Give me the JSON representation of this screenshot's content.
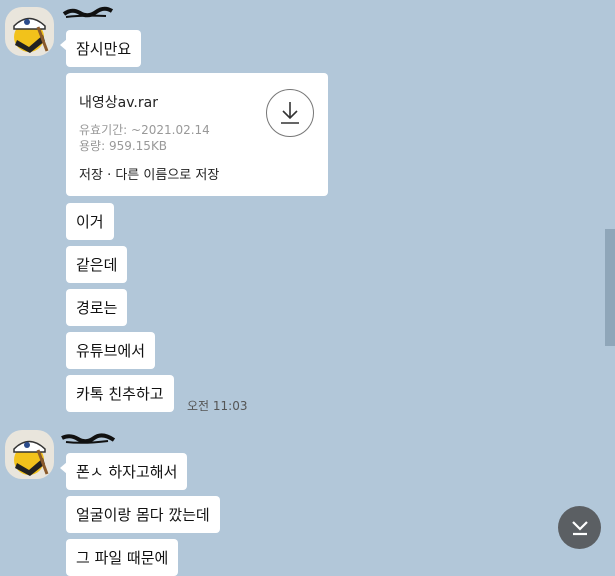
{
  "messages": [
    {
      "text": "잠시만요"
    },
    {
      "file": {
        "name": "내영상av.rar",
        "expiry_label": "유효기간:",
        "expiry_value": "~2021.02.14",
        "size_label": "용량:",
        "size_value": "959.15KB",
        "save_label": "저장",
        "separator": "·",
        "save_as_label": "다른 이름으로 저장"
      }
    },
    {
      "text": "이거"
    },
    {
      "text": "같은데"
    },
    {
      "text": "경로는"
    },
    {
      "text": "유튜브에서"
    },
    {
      "text": "카톡 친추하고",
      "time": "오전 11:03"
    },
    {
      "text": "폰ㅅ 하자고해서"
    },
    {
      "text": "얼굴이랑 몸다 깠는데"
    },
    {
      "text": "그 파일 때문에"
    }
  ],
  "icons": {
    "avatar": "avatar-icon",
    "download": "download-icon",
    "scroll_down": "scroll-to-bottom-icon"
  },
  "colors": {
    "background": "#b2c7d9",
    "bubble": "#ffffff",
    "scroll_button": "#5b5f63"
  }
}
